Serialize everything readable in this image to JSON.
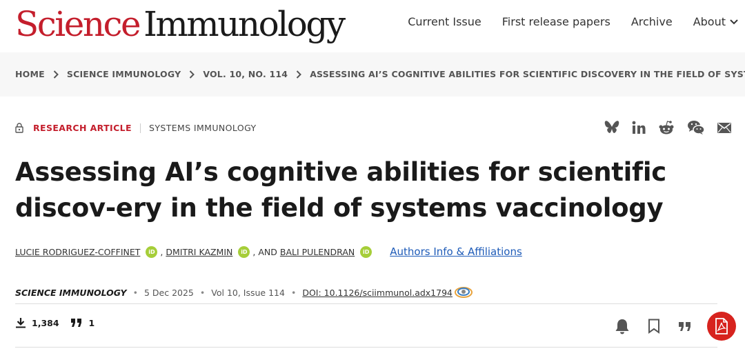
{
  "header": {
    "logo_science": "Science",
    "logo_immunology": "Immunology",
    "nav": [
      "Current Issue",
      "First release papers",
      "Archive",
      "About"
    ]
  },
  "breadcrumb": [
    "HOME",
    "SCIENCE IMMUNOLOGY",
    "VOL. 10, NO. 114",
    "ASSESSING AI’S COGNITIVE ABILITIES FOR SCIENTIFIC DISCOVERY IN THE FIELD OF SYSTEMS…"
  ],
  "article": {
    "type": "RESEARCH ARTICLE",
    "topic": "SYSTEMS IMMUNOLOGY",
    "title": "Assessing AI’s cognitive abilities for scientific discov-ery in the field of systems vaccinology",
    "authors": [
      "LUCIE RODRIGUEZ-COFFINET",
      "DMITRI KAZMIN",
      "BALI PULENDRAN"
    ],
    "author_sep1": ",",
    "author_sep2": ", AND",
    "orcid_label": "iD",
    "affiliations_link": "Authors Info & Affiliations",
    "journal": "SCIENCE IMMUNOLOGY",
    "date": "5 Dec 2025",
    "volume": "Vol 10, Issue 114",
    "doi": "DOI: 10.1126/sciimmunol.adx1794",
    "downloads": "1,384",
    "citations": "1"
  },
  "icons": {
    "share": [
      "bluesky-icon",
      "linkedin-icon",
      "reddit-icon",
      "wechat-icon",
      "email-icon"
    ],
    "tools": [
      "bell-icon",
      "bookmark-icon",
      "cite-icon",
      "pdf-icon"
    ]
  },
  "colors": {
    "brand_red": "#c41e2c",
    "link_blue": "#1e5bb8",
    "orcid_green": "#a6ce39",
    "pdf_red": "#d7231e"
  }
}
